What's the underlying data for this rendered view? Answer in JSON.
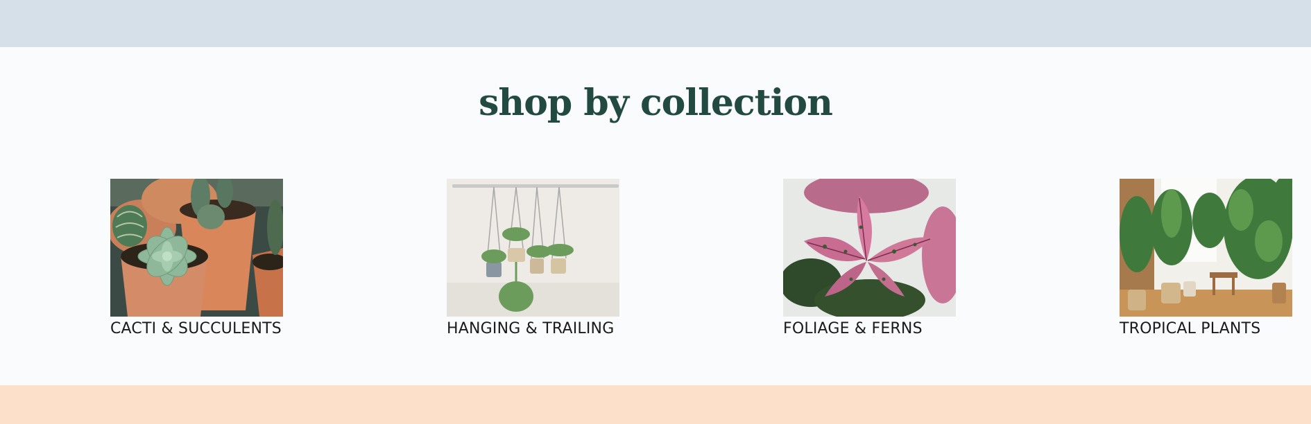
{
  "heading": "shop by collection",
  "collections": [
    {
      "label": "CACTI & SUCCULENTS",
      "image": "cacti-succulents-photo"
    },
    {
      "label": "HANGING & TRAILING",
      "image": "hanging-plants-photo"
    },
    {
      "label": "FOLIAGE & FERNS",
      "image": "polka-dot-plant-photo"
    },
    {
      "label": "TROPICAL PLANTS",
      "image": "tropical-room-photo"
    }
  ],
  "colors": {
    "top_band": "#d6e0e8",
    "background": "#f9fbfd",
    "bottom_band": "#fde0c9",
    "heading": "#234a40"
  }
}
